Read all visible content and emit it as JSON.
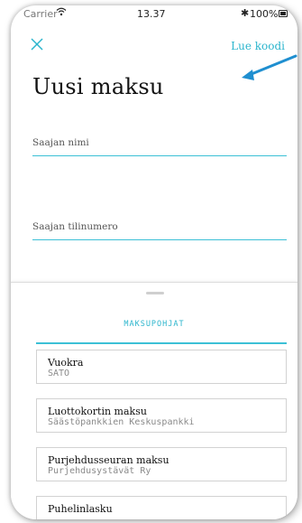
{
  "status_bar": {
    "carrier": "Carrier",
    "time": "13.37",
    "battery": "100%"
  },
  "header": {
    "read_code_label": "Lue koodi",
    "title": "Uusi maksu"
  },
  "form": {
    "recipient_name_placeholder": "Saajan nimi",
    "recipient_account_placeholder": "Saajan tilinumero"
  },
  "templates": {
    "section_title": "MAKSUPOHJAT",
    "items": [
      {
        "title": "Vuokra",
        "subtitle": "SATO"
      },
      {
        "title": "Luottokortin maksu",
        "subtitle": "Säästöpankkien Keskuspankki"
      },
      {
        "title": "Purjehdusseuran maksu",
        "subtitle": "Purjehdusystävät Ry"
      },
      {
        "title": "Puhelinlasku",
        "subtitle": ""
      }
    ]
  },
  "colors": {
    "accent": "#2bb5cd",
    "annotation_arrow": "#1f8fd0"
  }
}
